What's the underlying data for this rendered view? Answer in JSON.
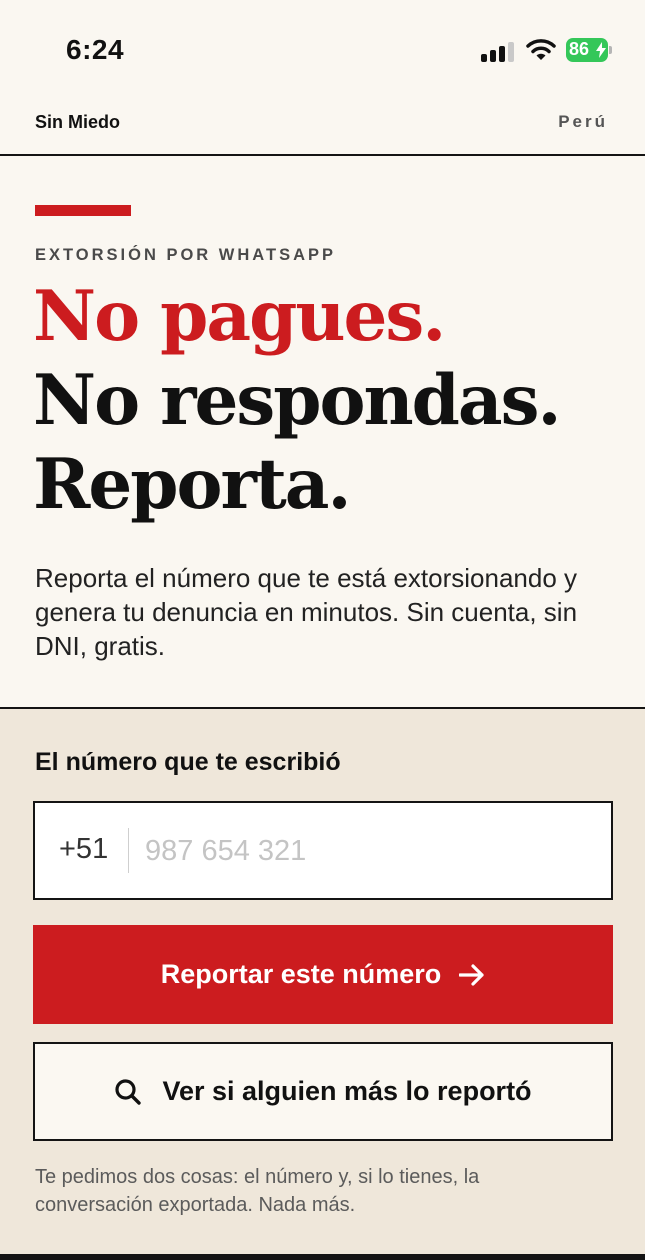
{
  "status_bar": {
    "time": "6:24",
    "battery": "86"
  },
  "nav": {
    "brand": "Sin Miedo",
    "country": "Perú"
  },
  "hero": {
    "kicker": "EXTORSIÓN POR WHATSAPP",
    "headline_1": "No pagues.",
    "headline_2": "No respondas.",
    "headline_3": "Reporta.",
    "lead": "Reporta el número que te está extorsionando y genera tu denuncia en minutos. Sin cuenta, sin DNI, gratis."
  },
  "form": {
    "label": "El número que te escribió",
    "prefix": "+51",
    "value": "",
    "placeholder": "987 654 321",
    "submit_label": "Reportar este número",
    "check_label": "Ver si alguien más lo reportó",
    "footnote": "Te pedimos dos cosas: el número y, si lo tienes, la conversación exportada. Nada más."
  },
  "colors": {
    "accent": "#cc1c1f",
    "ink": "#141414",
    "paper": "#faf7f1",
    "form_bg": "#efe7da",
    "battery": "#34c759"
  },
  "icons": {
    "submit": "arrow-right-icon",
    "check": "search-icon"
  }
}
